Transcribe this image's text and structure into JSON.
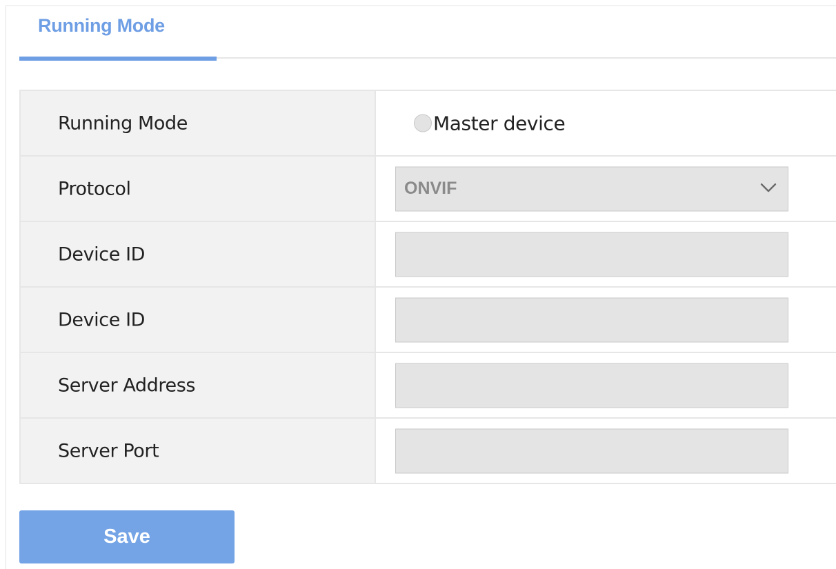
{
  "tab": {
    "title": "Running Mode",
    "accent_color": "#6e9ee4"
  },
  "form": {
    "rows": [
      {
        "label": "Running Mode",
        "control": "radio",
        "option_label": "Master device",
        "checked": false
      },
      {
        "label": "Protocol",
        "control": "select",
        "value": "ONVIF",
        "icon": "chevron-down-icon"
      },
      {
        "label": "Device ID",
        "control": "input",
        "value": ""
      },
      {
        "label": "Device ID",
        "control": "input",
        "value": ""
      },
      {
        "label": "Server Address",
        "control": "input",
        "value": ""
      },
      {
        "label": "Server Port",
        "control": "input",
        "value": ""
      }
    ]
  },
  "actions": {
    "save_label": "Save",
    "save_color": "#74a4e6"
  }
}
